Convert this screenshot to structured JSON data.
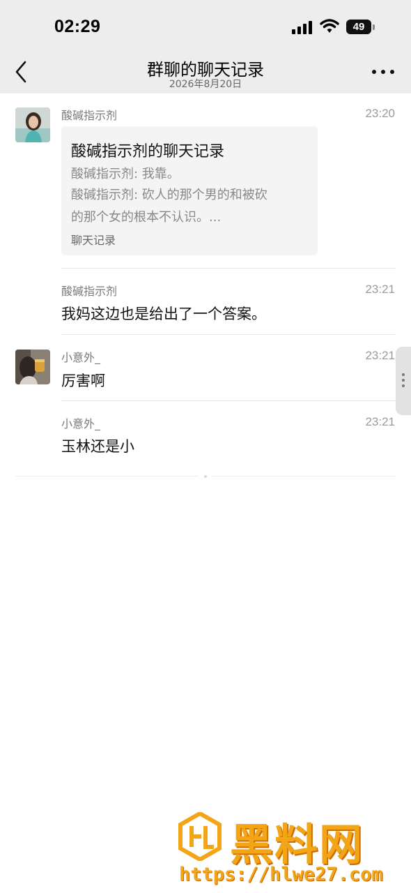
{
  "status_bar": {
    "time": "02:29",
    "battery": "49"
  },
  "header": {
    "title": "群聊的聊天记录",
    "subtitle": "2026年8月20日"
  },
  "messages": [
    {
      "sender": "酸碱指示剂",
      "time": "23:20",
      "card": {
        "title": "酸碱指示剂的聊天记录",
        "lines": [
          "酸碱指示剂: 我靠。",
          "酸碱指示剂: 砍人的那个男的和被砍",
          "的那个女的根本不认识。..."
        ],
        "footer": "聊天记录"
      }
    },
    {
      "sender": "酸碱指示剂",
      "time": "23:21",
      "text": "我妈这边也是给出了一个答案。"
    },
    {
      "sender": "小意外_",
      "time": "23:21",
      "text": "厉害啊"
    },
    {
      "sender": "小意外_",
      "time": "23:21",
      "text": "玉林还是小"
    }
  ],
  "watermark": {
    "brand": "黑料网",
    "url": "https://hlwe27.com"
  },
  "colors": {
    "header_bg": "#ededed",
    "card_bg": "#f4f4f4",
    "watermark": "#f2a516"
  }
}
